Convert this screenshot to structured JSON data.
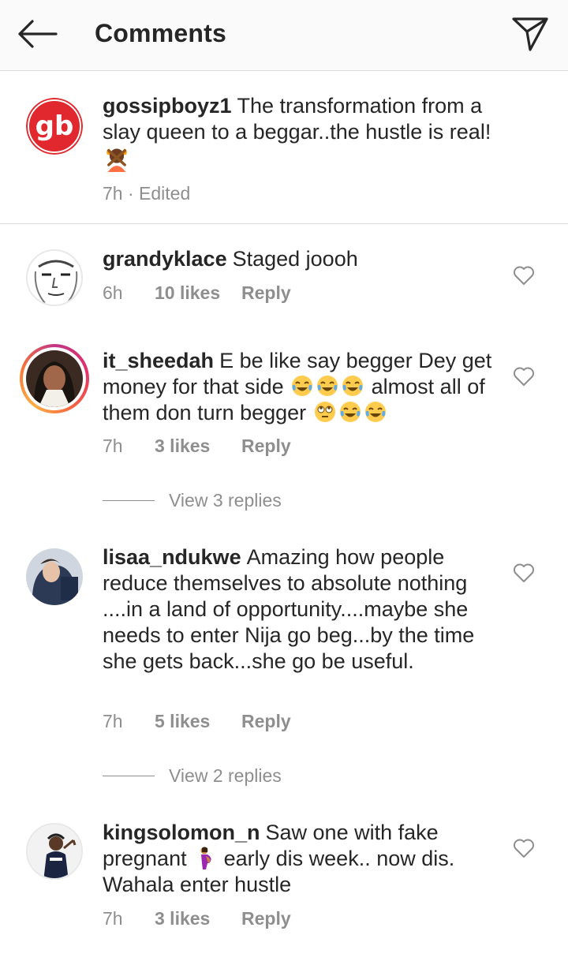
{
  "header": {
    "title": "Comments",
    "back_icon": "back-arrow-icon",
    "send_icon": "paper-plane-icon"
  },
  "caption": {
    "username": "gossipboyz1",
    "avatar_text": "gb",
    "text": "The transformation from a slay queen to a beggar..the hustle is real!",
    "time": "7h · Edited"
  },
  "comments": [
    {
      "username": "grandyklace",
      "text": "Staged joooh",
      "time": "6h",
      "likes": "10 likes",
      "reply": "Reply"
    },
    {
      "username": "it_sheedah",
      "text_a": "E be like say begger Dey get money for that side",
      "text_b": "almost all of them don turn begger",
      "time": "7h",
      "likes": "3 likes",
      "reply": "Reply",
      "view_replies": "View 3 replies"
    },
    {
      "username": "lisaa_ndukwe",
      "text": "Amazing how people reduce themselves to absolute nothing ....in a land of opportunity....maybe she needs to enter Nija go beg...by the time she gets back...she go be useful.",
      "time": "7h",
      "likes": "5 likes",
      "reply": "Reply",
      "view_replies": "View 2 replies"
    },
    {
      "username": "kingsolomon_n",
      "text_a": "Saw one with fake pregnant",
      "text_b": "early dis week.. now dis. Wahala enter hustle",
      "time": "7h",
      "likes": "3 likes",
      "reply": "Reply"
    }
  ],
  "colors": {
    "caption_avatar_red": "#e0282e",
    "meta_gray": "#8e8e8e",
    "divider": "#dbdbdb"
  }
}
